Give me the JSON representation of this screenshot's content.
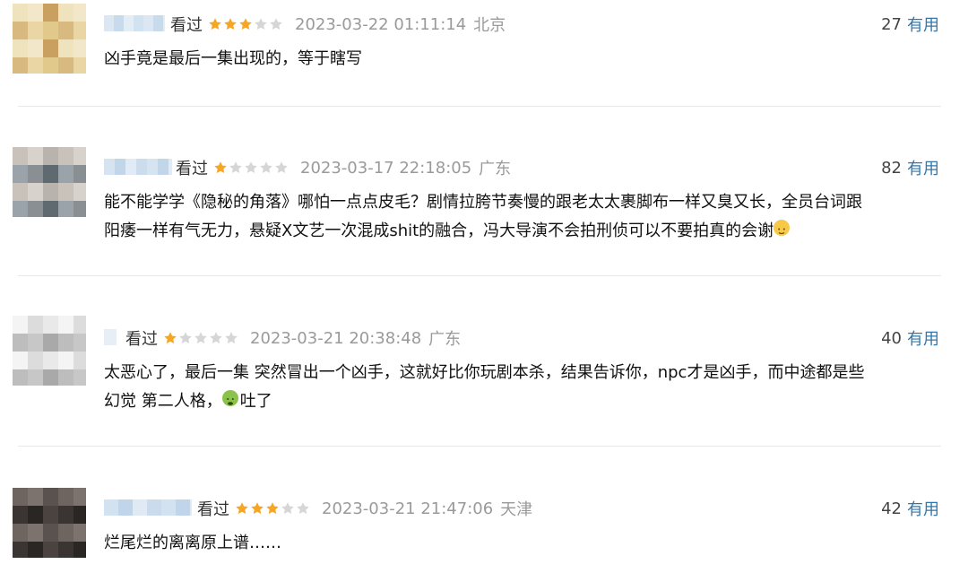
{
  "reviews": [
    {
      "status": "看过",
      "rating": 3,
      "datetime": "2023-03-22 01:11:14",
      "location": "北京",
      "votes": "27",
      "useful_label": "有用",
      "text": "凶手竟是最后一集出现的，等于瞎写",
      "text2": "",
      "emoji": "",
      "avatar_colors": [
        "#efe3bd",
        "#e1c98b",
        "#f2e7c9",
        "#d8b980",
        "#c9a060",
        "#ead6a4"
      ],
      "name_blur_colors": [
        "#dbe7f3",
        "#c8dbec",
        "#e3edf6",
        "#d1e2f0"
      ]
    },
    {
      "status": "看过",
      "rating": 1,
      "datetime": "2023-03-17 22:18:05",
      "location": "广东",
      "votes": "82",
      "useful_label": "有用",
      "text": "能不能学学《隐秘的角落》哪怕一点点皮毛？剧情拉胯节奏慢的跟老太太裹脚布一样又臭又长，全员台词跟",
      "text2": "阳痿一样有气无力，悬疑X文艺一次混成shit的融合，冯大导演不会拍刑侦可以不要拍真的会谢",
      "emoji": "smile",
      "avatar_colors": [
        "#8a8f94",
        "#c9c2bb",
        "#5f6970",
        "#d8d2cc",
        "#9aa3aa",
        "#b9b3ad"
      ],
      "name_blur_colors": [
        "#d6e4f1",
        "#c2d6ea",
        "#e0ebf5",
        "#cbdcec"
      ]
    },
    {
      "status": "看过",
      "rating": 1,
      "datetime": "2023-03-21 20:38:48",
      "location": "广东",
      "votes": "40",
      "useful_label": "有用",
      "text": "太恶心了，最后一集 突然冒出一个凶手，这就好比你玩剧本杀，结果告诉你，npc才是凶手，而中途都是些",
      "text2": "幻觉 第二人格，吐了",
      "emoji": "sick",
      "avatar_colors": [
        "#e9e9e9",
        "#c7c7c7",
        "#f4f4f4",
        "#a9a9a9",
        "#dcdcdc",
        "#bdbdbd"
      ],
      "name_blur_colors": [
        "#e8eef5"
      ]
    },
    {
      "status": "看过",
      "rating": 3,
      "datetime": "2023-03-21 21:47:06",
      "location": "天津",
      "votes": "42",
      "useful_label": "有用",
      "text": "烂尾烂的离离原上谱……",
      "text2": "",
      "emoji": "",
      "avatar_colors": [
        "#3a3533",
        "#5a524e",
        "#2a2624",
        "#6e6460",
        "#4a4340",
        "#7d736e"
      ],
      "name_blur_colors": [
        "#d3e2f0",
        "#c0d5e9",
        "#dfeaf5",
        "#c9dbec"
      ]
    }
  ],
  "colors": {
    "star_on": "#f6a623",
    "star_off": "#d6d6d6",
    "useful": "#3377aa",
    "meta_gray": "#9a9a9a"
  }
}
